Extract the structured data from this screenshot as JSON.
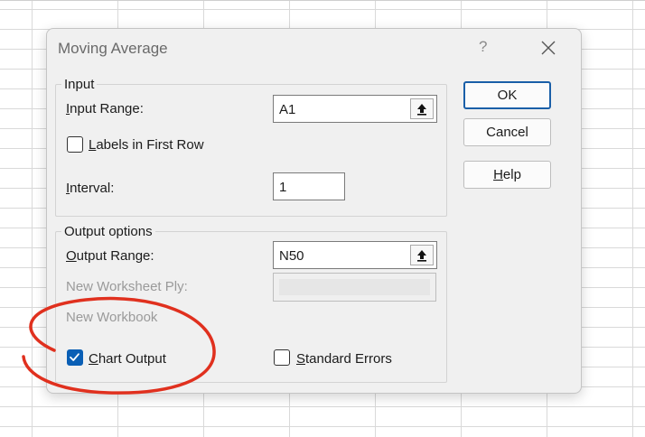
{
  "dialog": {
    "title": "Moving Average",
    "help_glyph": "?"
  },
  "input_group": {
    "legend": "Input",
    "input_range_label": "Input Range:",
    "input_range_value": "A1",
    "labels_first_row_label": "Labels in First Row",
    "labels_first_row_checked": false,
    "interval_label": "Interval:",
    "interval_value": "1"
  },
  "output_group": {
    "legend": "Output options",
    "output_range_label": "Output Range:",
    "output_range_value": "N50",
    "new_worksheet_label": "New Worksheet Ply:",
    "new_workbook_label": "New Workbook",
    "chart_output_label": "Chart Output",
    "chart_output_checked": true,
    "standard_errors_label": "Standard Errors",
    "standard_errors_checked": false
  },
  "buttons": {
    "ok": "OK",
    "cancel": "Cancel",
    "help": "Help"
  },
  "icons": {
    "collapse": "collapse-dialog-icon",
    "close": "close-icon",
    "checkmark": "checkmark-icon"
  },
  "colors": {
    "accent": "#0a5fb5",
    "annotation": "#e0301e"
  }
}
